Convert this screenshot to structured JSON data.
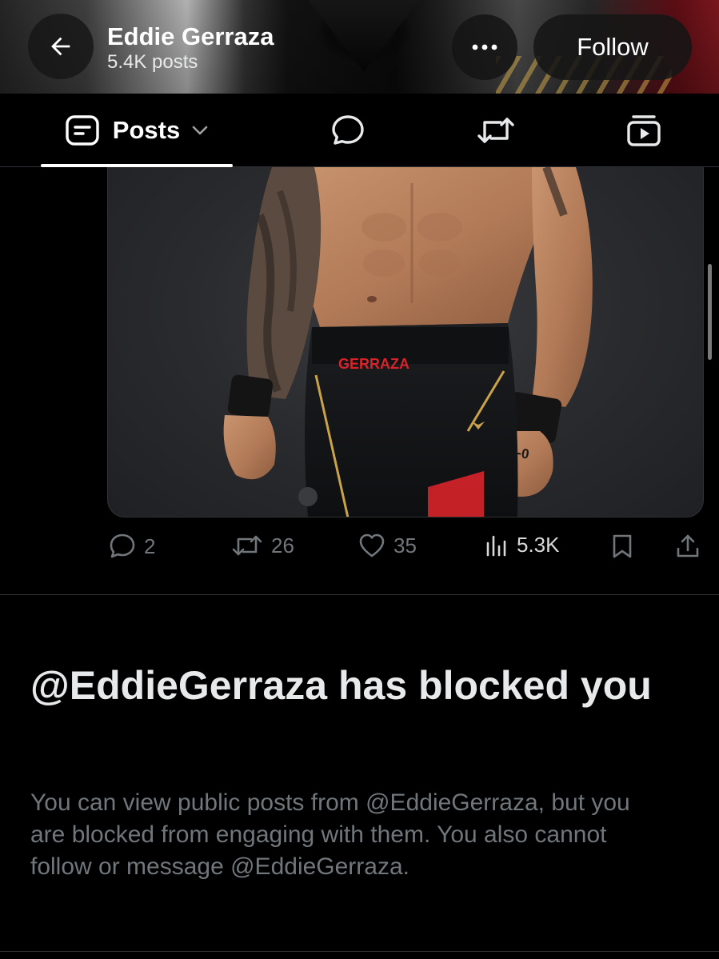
{
  "header": {
    "name": "Eddie Gerraza",
    "posts_count": "5.4K posts",
    "follow_label": "Follow",
    "back_icon": "arrow-left-icon",
    "more_icon": "more-dots-icon"
  },
  "tabs": [
    {
      "label": "Posts",
      "icon": "posts-icon",
      "active": true
    },
    {
      "icon": "replies-icon"
    },
    {
      "icon": "reposts-icon"
    },
    {
      "icon": "media-icon"
    }
  ],
  "post": {
    "shorts_text": "GERRAZA",
    "knuckle_text": "21-0",
    "stats": {
      "replies": "2",
      "reposts": "26",
      "likes": "35",
      "views": "5.3K"
    }
  },
  "blocked": {
    "title": "@EddieGerraza has blocked you",
    "body": "You can view public posts from @EddieGerraza, but you are blocked from engaging with them. You also cannot follow or message @EddieGerraza."
  },
  "colors": {
    "background": "#000000",
    "text_primary": "#e7e9ea",
    "text_secondary": "#71767b",
    "divider": "#2f3336"
  }
}
